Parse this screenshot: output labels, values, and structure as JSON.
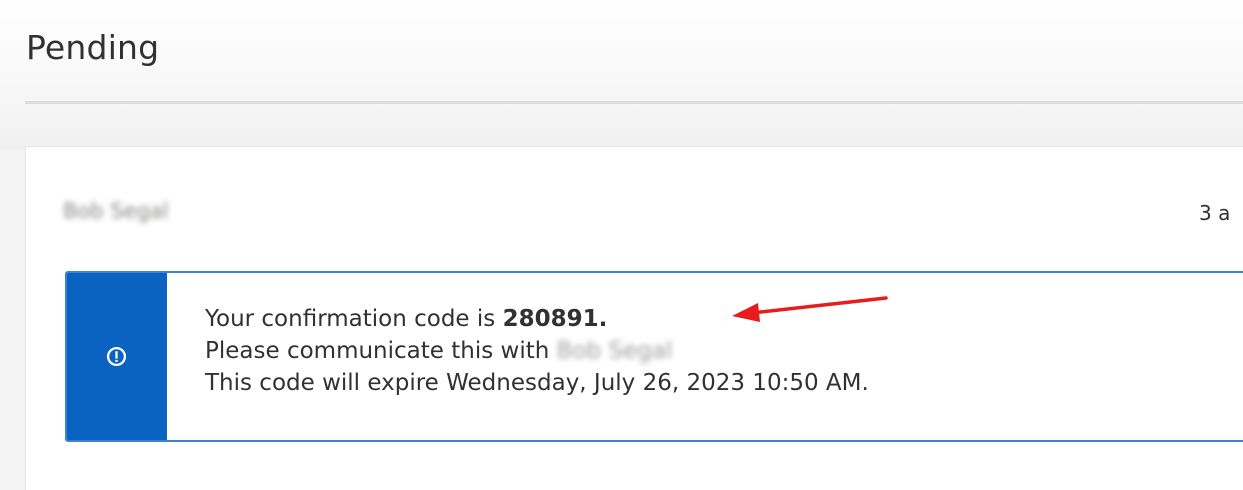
{
  "header": {
    "title": "Pending"
  },
  "message": {
    "sender": "Bob Segal",
    "timestamp": "3 a",
    "line1_prefix": "Your confirmation code is ",
    "code": "280891.",
    "line2_prefix": "Please communicate this with ",
    "recipient": "Bob Segal",
    "line3": "This code will expire Wednesday, July 26, 2023 10:50 AM.",
    "icon": "info-icon"
  },
  "colors": {
    "accent": "#0a63c0",
    "border": "#3b82d6",
    "annotation_arrow": "#e81c1c"
  }
}
